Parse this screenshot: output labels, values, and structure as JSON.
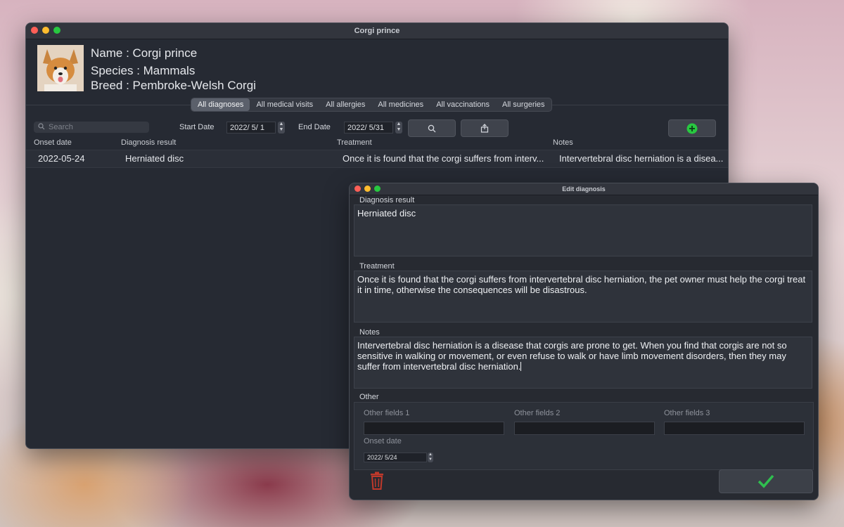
{
  "main_window": {
    "title": "Corgi prince",
    "name_line": "Name : Corgi prince",
    "species_line": "Species : Mammals",
    "breed_line": "Breed : Pembroke-Welsh Corgi",
    "tabs": [
      {
        "label": "All diagnoses",
        "active": true
      },
      {
        "label": "All medical visits"
      },
      {
        "label": "All allergies"
      },
      {
        "label": "All medicines"
      },
      {
        "label": "All vaccinations"
      },
      {
        "label": "All surgeries"
      }
    ],
    "search_placeholder": "Search",
    "start_date_label": "Start Date",
    "start_date_value": "2022/  5/  1",
    "end_date_label": "End Date",
    "end_date_value": "2022/  5/31",
    "columns": [
      "Onset date",
      "Diagnosis result",
      "Treatment",
      "Notes"
    ],
    "rows": [
      {
        "onset": "2022-05-24",
        "diagnosis": "Herniated disc",
        "treatment": "Once it is found that the corgi suffers from interv...",
        "notes": "Intervertebral disc herniation is a disea..."
      }
    ]
  },
  "dialog": {
    "title": "Edit diagnosis",
    "diagnosis_label": "Diagnosis result",
    "diagnosis_value": "Herniated disc",
    "treatment_label": "Treatment",
    "treatment_value": "Once it is found that the corgi suffers from intervertebral disc herniation, the pet owner must help the corgi treat it in time, otherwise the consequences will be disastrous.",
    "notes_label": "Notes",
    "notes_value": "Intervertebral disc herniation is a disease that corgis are prone to get. When you find that corgis are not so sensitive in walking or movement, or even refuse to walk or have limb movement disorders, then they may suffer from intervertebral disc herniation.",
    "other_label": "Other",
    "other_fields": [
      "Other fields 1",
      "Other fields 2",
      "Other fields 3"
    ],
    "onset_label": "Onset date",
    "onset_value": "2022/  5/24"
  },
  "colors": {
    "add_green": "#28c840",
    "confirm_green": "#2fbf4f",
    "delete_red": "#c0392b"
  },
  "icons": [
    "search-icon",
    "export-icon",
    "add-icon",
    "trash-icon",
    "checkmark-icon"
  ]
}
